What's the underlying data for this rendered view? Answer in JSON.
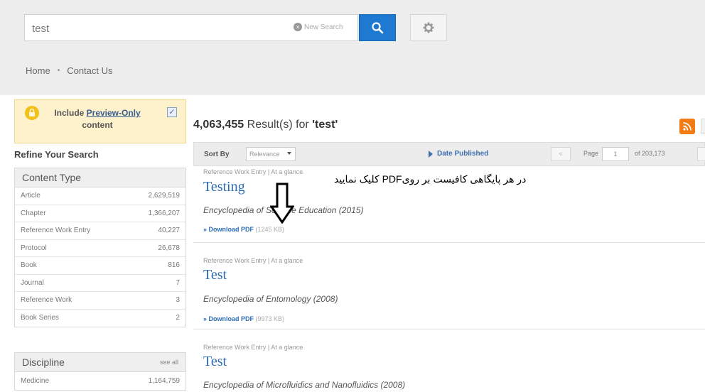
{
  "search": {
    "query": "test",
    "new_search_label": "New Search"
  },
  "breadcrumb": {
    "home": "Home",
    "separator": "•",
    "contact": "Contact Us"
  },
  "sidebar": {
    "preview_text_before": "Include ",
    "preview_link": "Preview-Only",
    "preview_text_after": " content",
    "preview_checked": "✓",
    "refine_title": "Refine Your Search",
    "content_type": {
      "title": "Content Type",
      "rows": [
        {
          "label": "Article",
          "count": "2,629,519"
        },
        {
          "label": "Chapter",
          "count": "1,366,207"
        },
        {
          "label": "Reference Work Entry",
          "count": "40,227"
        },
        {
          "label": "Protocol",
          "count": "26,678"
        },
        {
          "label": "Book",
          "count": "816"
        },
        {
          "label": "Journal",
          "count": "7"
        },
        {
          "label": "Reference Work",
          "count": "3"
        },
        {
          "label": "Book Series",
          "count": "2"
        }
      ]
    },
    "discipline": {
      "title": "Discipline",
      "see_all": "see all",
      "rows": [
        {
          "label": "Medicine",
          "count": "1,164,759"
        }
      ]
    }
  },
  "results": {
    "count": "4,063,455",
    "label_mid": " Result(s) for ",
    "query_quoted": "'test'"
  },
  "sortbar": {
    "sort_by": "Sort By",
    "sort_value": "Relevance",
    "date_published": "Date Published",
    "prev": "«",
    "page_label": "Page",
    "page_value": "1",
    "page_of": "of 203,173"
  },
  "annotation": "در هر پایگاهی کافیست بر رویPDF کلیک نمایید",
  "items": [
    {
      "meta": "Reference Work Entry  |  At a glance",
      "title": "Testing",
      "source": "Encyclopedia of Science Education (2015)",
      "download": "» Download PDF",
      "size": "(1245 KB)"
    },
    {
      "meta": "Reference Work Entry  |  At a glance",
      "title": "Test",
      "source": "Encyclopedia of Entomology (2008)",
      "download": "» Download PDF",
      "size": "(9973 KB)"
    },
    {
      "meta": "Reference Work Entry  |  At a glance",
      "title": "Test",
      "source": "Encyclopedia of Microfluidics and Nanofluidics (2008)",
      "download": "",
      "size": ""
    }
  ],
  "colors": {
    "accent_blue": "#1d7ad0",
    "link_blue": "#2d6db6",
    "rss_orange": "#f27b16",
    "preview_bg": "#fdf2cc"
  }
}
